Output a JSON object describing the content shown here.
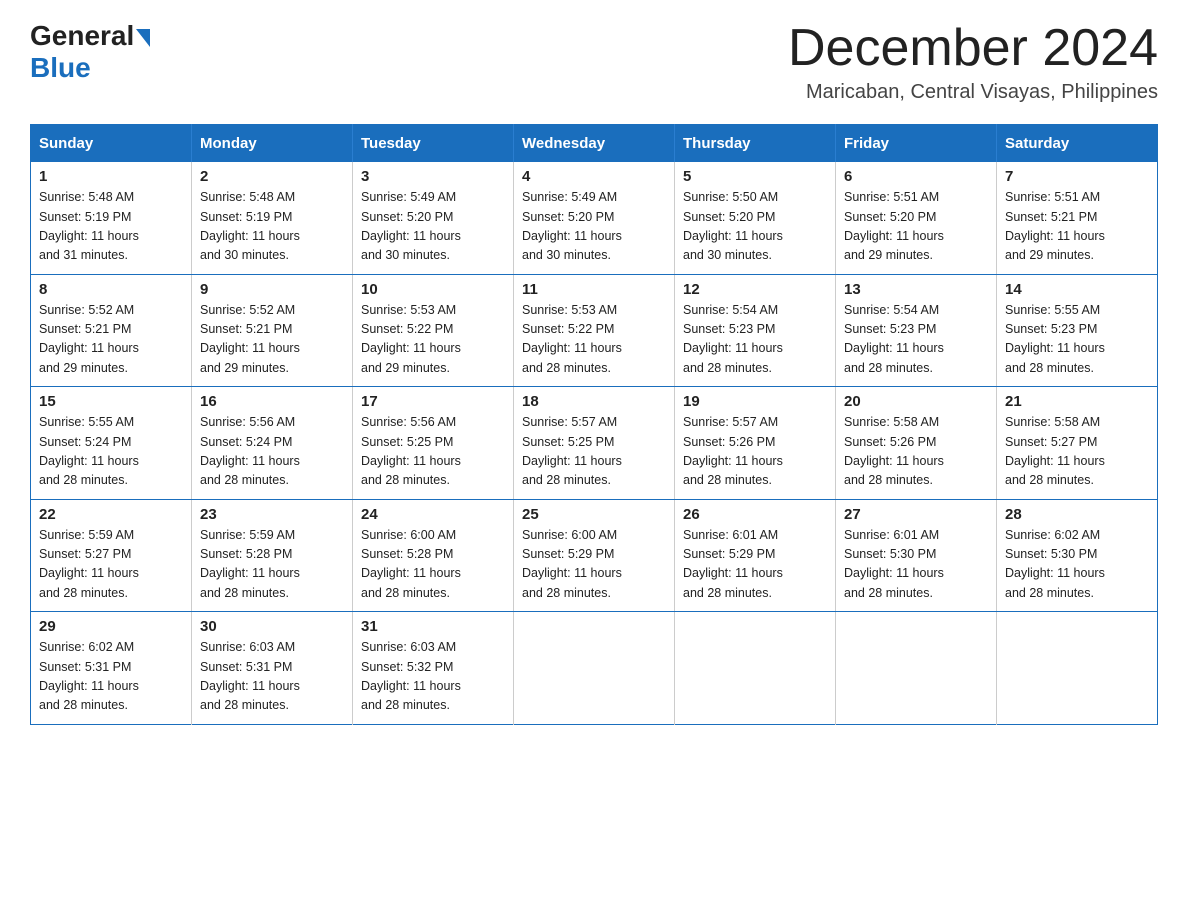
{
  "header": {
    "logo_general": "General",
    "logo_blue": "Blue",
    "month_title": "December 2024",
    "location": "Maricaban, Central Visayas, Philippines"
  },
  "weekdays": [
    "Sunday",
    "Monday",
    "Tuesday",
    "Wednesday",
    "Thursday",
    "Friday",
    "Saturday"
  ],
  "weeks": [
    [
      {
        "day": "1",
        "sunrise": "5:48 AM",
        "sunset": "5:19 PM",
        "daylight": "11 hours and 31 minutes."
      },
      {
        "day": "2",
        "sunrise": "5:48 AM",
        "sunset": "5:19 PM",
        "daylight": "11 hours and 30 minutes."
      },
      {
        "day": "3",
        "sunrise": "5:49 AM",
        "sunset": "5:20 PM",
        "daylight": "11 hours and 30 minutes."
      },
      {
        "day": "4",
        "sunrise": "5:49 AM",
        "sunset": "5:20 PM",
        "daylight": "11 hours and 30 minutes."
      },
      {
        "day": "5",
        "sunrise": "5:50 AM",
        "sunset": "5:20 PM",
        "daylight": "11 hours and 30 minutes."
      },
      {
        "day": "6",
        "sunrise": "5:51 AM",
        "sunset": "5:20 PM",
        "daylight": "11 hours and 29 minutes."
      },
      {
        "day": "7",
        "sunrise": "5:51 AM",
        "sunset": "5:21 PM",
        "daylight": "11 hours and 29 minutes."
      }
    ],
    [
      {
        "day": "8",
        "sunrise": "5:52 AM",
        "sunset": "5:21 PM",
        "daylight": "11 hours and 29 minutes."
      },
      {
        "day": "9",
        "sunrise": "5:52 AM",
        "sunset": "5:21 PM",
        "daylight": "11 hours and 29 minutes."
      },
      {
        "day": "10",
        "sunrise": "5:53 AM",
        "sunset": "5:22 PM",
        "daylight": "11 hours and 29 minutes."
      },
      {
        "day": "11",
        "sunrise": "5:53 AM",
        "sunset": "5:22 PM",
        "daylight": "11 hours and 28 minutes."
      },
      {
        "day": "12",
        "sunrise": "5:54 AM",
        "sunset": "5:23 PM",
        "daylight": "11 hours and 28 minutes."
      },
      {
        "day": "13",
        "sunrise": "5:54 AM",
        "sunset": "5:23 PM",
        "daylight": "11 hours and 28 minutes."
      },
      {
        "day": "14",
        "sunrise": "5:55 AM",
        "sunset": "5:23 PM",
        "daylight": "11 hours and 28 minutes."
      }
    ],
    [
      {
        "day": "15",
        "sunrise": "5:55 AM",
        "sunset": "5:24 PM",
        "daylight": "11 hours and 28 minutes."
      },
      {
        "day": "16",
        "sunrise": "5:56 AM",
        "sunset": "5:24 PM",
        "daylight": "11 hours and 28 minutes."
      },
      {
        "day": "17",
        "sunrise": "5:56 AM",
        "sunset": "5:25 PM",
        "daylight": "11 hours and 28 minutes."
      },
      {
        "day": "18",
        "sunrise": "5:57 AM",
        "sunset": "5:25 PM",
        "daylight": "11 hours and 28 minutes."
      },
      {
        "day": "19",
        "sunrise": "5:57 AM",
        "sunset": "5:26 PM",
        "daylight": "11 hours and 28 minutes."
      },
      {
        "day": "20",
        "sunrise": "5:58 AM",
        "sunset": "5:26 PM",
        "daylight": "11 hours and 28 minutes."
      },
      {
        "day": "21",
        "sunrise": "5:58 AM",
        "sunset": "5:27 PM",
        "daylight": "11 hours and 28 minutes."
      }
    ],
    [
      {
        "day": "22",
        "sunrise": "5:59 AM",
        "sunset": "5:27 PM",
        "daylight": "11 hours and 28 minutes."
      },
      {
        "day": "23",
        "sunrise": "5:59 AM",
        "sunset": "5:28 PM",
        "daylight": "11 hours and 28 minutes."
      },
      {
        "day": "24",
        "sunrise": "6:00 AM",
        "sunset": "5:28 PM",
        "daylight": "11 hours and 28 minutes."
      },
      {
        "day": "25",
        "sunrise": "6:00 AM",
        "sunset": "5:29 PM",
        "daylight": "11 hours and 28 minutes."
      },
      {
        "day": "26",
        "sunrise": "6:01 AM",
        "sunset": "5:29 PM",
        "daylight": "11 hours and 28 minutes."
      },
      {
        "day": "27",
        "sunrise": "6:01 AM",
        "sunset": "5:30 PM",
        "daylight": "11 hours and 28 minutes."
      },
      {
        "day": "28",
        "sunrise": "6:02 AM",
        "sunset": "5:30 PM",
        "daylight": "11 hours and 28 minutes."
      }
    ],
    [
      {
        "day": "29",
        "sunrise": "6:02 AM",
        "sunset": "5:31 PM",
        "daylight": "11 hours and 28 minutes."
      },
      {
        "day": "30",
        "sunrise": "6:03 AM",
        "sunset": "5:31 PM",
        "daylight": "11 hours and 28 minutes."
      },
      {
        "day": "31",
        "sunrise": "6:03 AM",
        "sunset": "5:32 PM",
        "daylight": "11 hours and 28 minutes."
      },
      null,
      null,
      null,
      null
    ]
  ]
}
